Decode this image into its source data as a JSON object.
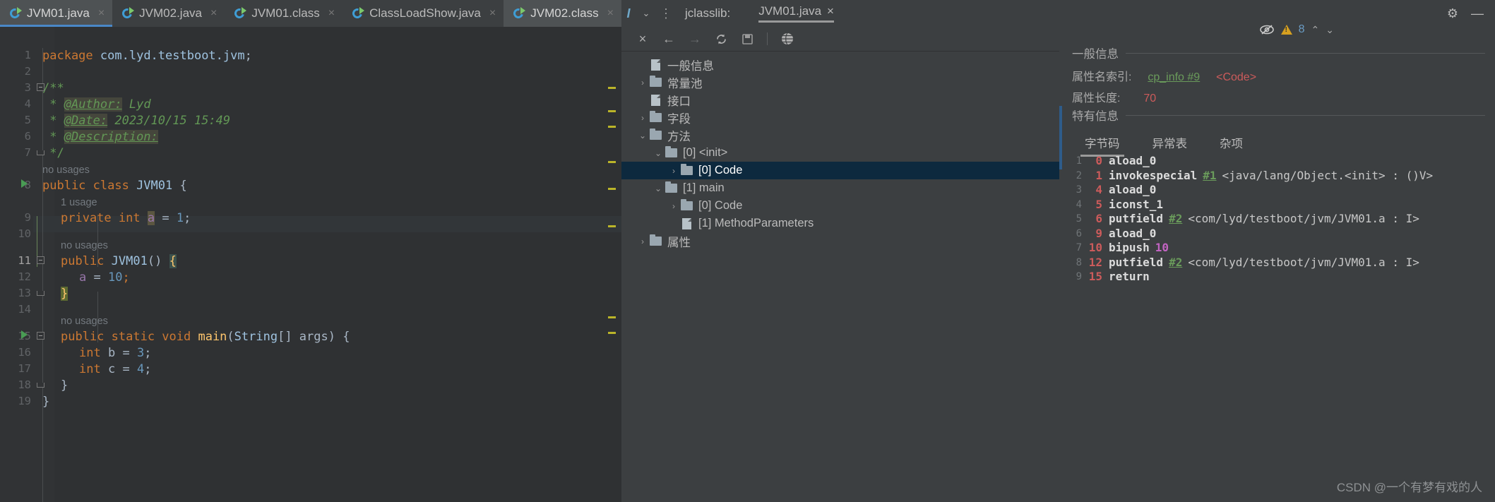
{
  "tabs": [
    {
      "label": "JVM01.java",
      "active": true,
      "close": "×"
    },
    {
      "label": "JVM02.java",
      "active": false,
      "close": "×"
    },
    {
      "label": "JVM01.class",
      "active": false,
      "close": "×"
    },
    {
      "label": "ClassLoadShow.java",
      "active": false,
      "close": "×"
    },
    {
      "label": "JVM02.class",
      "active": true,
      "close": "×"
    }
  ],
  "tabbar": {
    "italic_button": "I",
    "chevron": "⌄",
    "more": "⋮",
    "jclasslib_label": "jclasslib:",
    "jclasslib_tab": "JVM01.java",
    "jclasslib_tab_close": "×",
    "gear": "⚙",
    "minimize": "—"
  },
  "editor": {
    "warnings": {
      "count": "8",
      "eye_icon": "inspection-widget-eye",
      "up": "⌃",
      "down": "⌄"
    },
    "lines": [
      {
        "n": "1",
        "text": "package com.lyd.testboot.jvm;"
      },
      {
        "n": "2",
        "text": ""
      },
      {
        "n": "3",
        "text": "/**"
      },
      {
        "n": "4",
        "text": " * @Author: Lyd"
      },
      {
        "n": "5",
        "text": " * @Date: 2023/10/15 15:49"
      },
      {
        "n": "6",
        "text": " * @Description:"
      },
      {
        "n": "7",
        "text": " */"
      },
      {
        "n": "8",
        "text": "public class JVM01 {"
      },
      {
        "n": "9",
        "text": "    private int a = 1;"
      },
      {
        "n": "10",
        "text": ""
      },
      {
        "n": "11",
        "text": "    public JVM01() {"
      },
      {
        "n": "12",
        "text": "        a = 10;"
      },
      {
        "n": "13",
        "text": "    }"
      },
      {
        "n": "14",
        "text": ""
      },
      {
        "n": "15",
        "text": "    public static void main(String[] args) {"
      },
      {
        "n": "16",
        "text": "        int b = 3;"
      },
      {
        "n": "17",
        "text": "        int c = 4;"
      },
      {
        "n": "18",
        "text": "    }"
      },
      {
        "n": "19",
        "text": "}"
      }
    ],
    "hints": [
      {
        "text": "no usages",
        "line": 7
      },
      {
        "text": "1 usage",
        "line": 8
      },
      {
        "text": "no usages",
        "line": 10
      },
      {
        "text": "no usages",
        "line": 14
      }
    ]
  },
  "jclasslib_toolbar": {
    "close": "×",
    "back": "←",
    "forward": "→",
    "reload": "⟳",
    "save": "⬜",
    "browse": "ἱ0"
  },
  "tree": [
    {
      "label": "一般信息",
      "indent": 1,
      "twist": "",
      "icon": "file",
      "selected": false
    },
    {
      "label": "常量池",
      "indent": 0,
      "twist": "›",
      "icon": "folder",
      "selected": false
    },
    {
      "label": "接口",
      "indent": 1,
      "twist": "",
      "icon": "file",
      "selected": false
    },
    {
      "label": "字段",
      "indent": 0,
      "twist": "›",
      "icon": "folder",
      "selected": false
    },
    {
      "label": "方法",
      "indent": 0,
      "twist": "⌄",
      "icon": "folder",
      "selected": false
    },
    {
      "label": "[0] <init>",
      "indent": 1,
      "twist": "⌄",
      "icon": "folder",
      "selected": false
    },
    {
      "label": "[0] Code",
      "indent": 2,
      "twist": "›",
      "icon": "folder",
      "selected": true
    },
    {
      "label": "[1] main",
      "indent": 1,
      "twist": "⌄",
      "icon": "folder",
      "selected": false
    },
    {
      "label": "[0] Code",
      "indent": 2,
      "twist": "›",
      "icon": "folder",
      "selected": false
    },
    {
      "label": "[1] MethodParameters",
      "indent": 2,
      "twist": "",
      "icon": "file",
      "selected": false
    },
    {
      "label": "属性",
      "indent": 0,
      "twist": "›",
      "icon": "folder",
      "selected": false
    }
  ],
  "detail": {
    "general_title": "一般信息",
    "attr_name_label": "属性名索引:",
    "attr_name_link": "cp_info #9",
    "attr_name_code": "<Code>",
    "attr_len_label": "属性长度:",
    "attr_len_value": "70",
    "specific_title": "特有信息",
    "tabs": [
      {
        "label": "字节码",
        "active": true
      },
      {
        "label": "异常表",
        "active": false
      },
      {
        "label": "杂项",
        "active": false
      }
    ],
    "bytecode": [
      {
        "n": "1",
        "off": "0",
        "op": "aload_0",
        "ref": "",
        "desc": "",
        "lit": ""
      },
      {
        "n": "2",
        "off": "1",
        "op": "invokespecial",
        "ref": "#1",
        "desc": "<java/lang/Object.<init> : ()V>",
        "lit": ""
      },
      {
        "n": "3",
        "off": "4",
        "op": "aload_0",
        "ref": "",
        "desc": "",
        "lit": ""
      },
      {
        "n": "4",
        "off": "5",
        "op": "iconst_1",
        "ref": "",
        "desc": "",
        "lit": ""
      },
      {
        "n": "5",
        "off": "6",
        "op": "putfield",
        "ref": "#2",
        "desc": "<com/lyd/testboot/jvm/JVM01.a : I>",
        "lit": ""
      },
      {
        "n": "6",
        "off": "9",
        "op": "aload_0",
        "ref": "",
        "desc": "",
        "lit": ""
      },
      {
        "n": "7",
        "off": "10",
        "op": "bipush",
        "ref": "",
        "desc": "",
        "lit": "10"
      },
      {
        "n": "8",
        "off": "12",
        "op": "putfield",
        "ref": "#2",
        "desc": "<com/lyd/testboot/jvm/JVM01.a : I>",
        "lit": ""
      },
      {
        "n": "9",
        "off": "15",
        "op": "return",
        "ref": "",
        "desc": "",
        "lit": ""
      }
    ]
  },
  "watermark": "CSDN @一个有梦有戏的人",
  "colors": {
    "accent": "#4a88c7",
    "selection": "#0d293e",
    "keyword": "#cc7832",
    "comment": "#629755",
    "number": "#6897bb",
    "link": "#6a9b5b",
    "value": "#cc5b5b"
  }
}
